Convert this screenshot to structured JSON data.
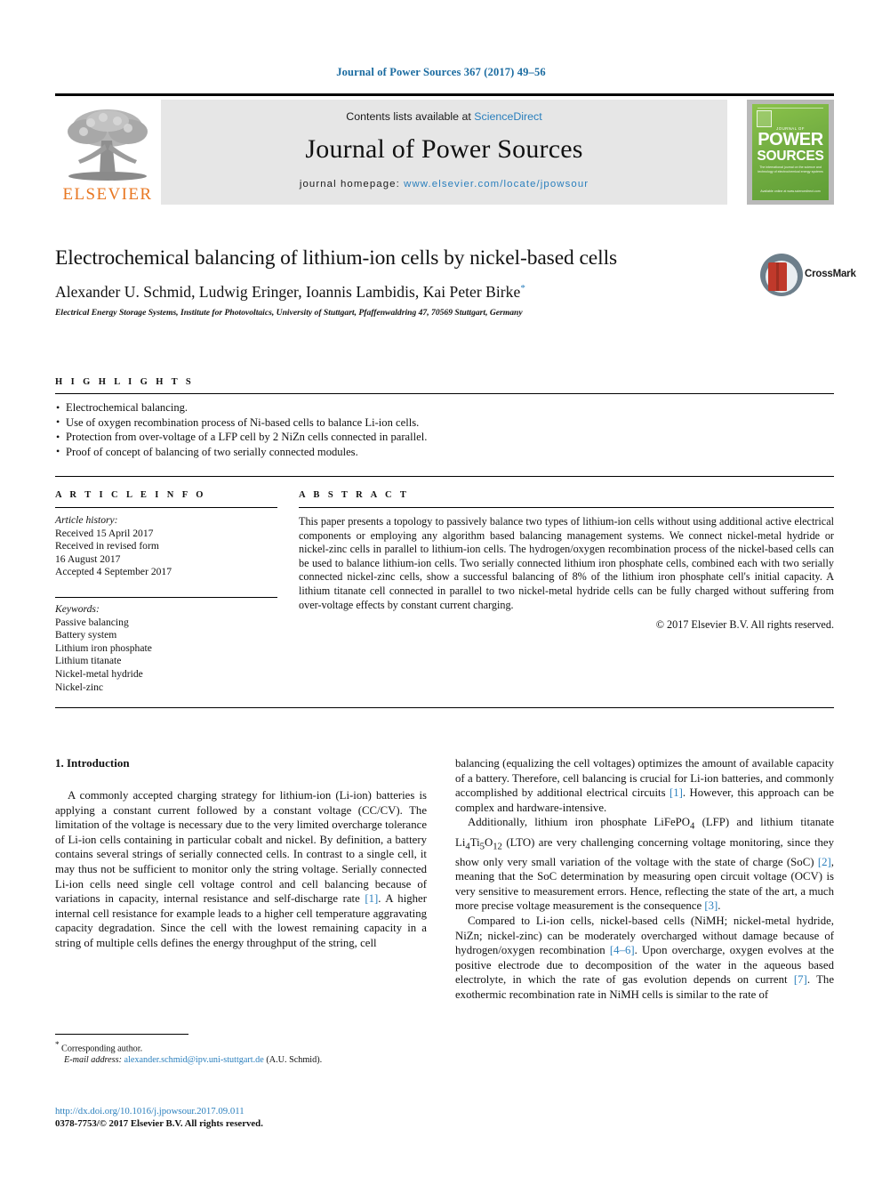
{
  "running_head": "Journal of Power Sources 367 (2017) 49–56",
  "masthead": {
    "contents_prefix": "Contents lists available at ",
    "sciencedirect": "ScienceDirect",
    "journal_title": "Journal of Power Sources",
    "homepage_label": "journal homepage: ",
    "homepage_url": "www.elsevier.com/locate/jpowsour",
    "publisher_wordmark": "ELSEVIER",
    "cover": {
      "eyebrow": "JOURNAL OF",
      "line1": "POWER",
      "line2": "SOURCES",
      "subtitle": "The international journal on the science and technology of electrochemical energy systems",
      "footer": "Available online at www.sciencedirect.com"
    }
  },
  "article": {
    "title": "Electrochemical balancing of lithium-ion cells by nickel-based cells",
    "authors": "Alexander U. Schmid, Ludwig Eringer, Ioannis Lambidis, Kai Peter Birke",
    "author_star": "*",
    "affiliation": "Electrical Energy Storage Systems, Institute for Photovoltaics, University of Stuttgart, Pfaffenwaldring 47, 70569 Stuttgart, Germany",
    "crossmark_label": "CrossMark"
  },
  "highlights": {
    "heading": "H I G H L I G H T S",
    "items": [
      "Electrochemical balancing.",
      "Use of oxygen recombination process of Ni-based cells to balance Li-ion cells.",
      "Protection from over-voltage of a LFP cell by 2 NiZn cells connected in parallel.",
      "Proof of concept of balancing of two serially connected modules."
    ]
  },
  "article_info": {
    "heading": "A R T I C L E   I N F O",
    "history_label": "Article history:",
    "history": [
      "Received 15 April 2017",
      "Received in revised form",
      "16 August 2017",
      "Accepted 4 September 2017"
    ],
    "keywords_label": "Keywords:",
    "keywords": [
      "Passive balancing",
      "Battery system",
      "Lithium iron phosphate",
      "Lithium titanate",
      "Nickel-metal hydride",
      "Nickel-zinc"
    ]
  },
  "abstract": {
    "heading": "A B S T R A C T",
    "text": "This paper presents a topology to passively balance two types of lithium-ion cells without using additional active electrical components or employing any algorithm based balancing management systems. We connect nickel-metal hydride or nickel-zinc cells in parallel to lithium-ion cells. The hydrogen/oxygen recombination process of the nickel-based cells can be used to balance lithium-ion cells. Two serially connected lithium iron phosphate cells, combined each with two serially connected nickel-zinc cells, show a successful balancing of 8% of the lithium iron phosphate cell's initial capacity. A lithium titanate cell connected in parallel to two nickel-metal hydride cells can be fully charged without suffering from over-voltage effects by constant current charging.",
    "copyright": "© 2017 Elsevier B.V. All rights reserved."
  },
  "body": {
    "section_heading": "1. Introduction",
    "left_p1_a": "A commonly accepted charging strategy for lithium-ion (Li-ion) batteries is applying a constant current followed by a constant voltage (CC/CV). The limitation of the voltage is necessary due to the very limited overcharge tolerance of Li-ion cells containing in particular cobalt and nickel. By definition, a battery contains several strings of serially connected cells. In contrast to a single cell, it may thus not be sufficient to monitor only the string voltage. Serially connected Li-ion cells need single cell voltage control and cell balancing because of variations in capacity, internal resistance and self-discharge rate ",
    "left_p1_ref": "[1]",
    "left_p1_b": ". A higher internal cell resistance for example leads to a higher cell temperature aggravating capacity degradation. Since the cell with the lowest remaining capacity in a string of multiple cells defines the energy throughput of the string, cell",
    "right_p1_a": "balancing (equalizing the cell voltages) optimizes the amount of available capacity of a battery. Therefore, cell balancing is crucial for Li-ion batteries, and commonly accomplished by additional electrical circuits ",
    "right_p1_ref": "[1]",
    "right_p1_b": ". However, this approach can be complex and hardware-intensive.",
    "right_p2_a": "Additionally, lithium iron phosphate LiFePO",
    "right_p2_sub1": "4",
    "right_p2_b": " (LFP) and lithium titanate Li",
    "right_p2_sub2": "4",
    "right_p2_c": "Ti",
    "right_p2_sub3": "5",
    "right_p2_d": "O",
    "right_p2_sub4": "12",
    "right_p2_e": " (LTO) are very challenging concerning voltage monitoring, since they show only very small variation of the voltage with the state of charge (SoC) ",
    "right_p2_ref1": "[2]",
    "right_p2_f": ", meaning that the SoC determination by measuring open circuit voltage (OCV) is very sensitive to measurement errors. Hence, reflecting the state of the art, a much more precise voltage measurement is the consequence ",
    "right_p2_ref2": "[3]",
    "right_p2_g": ".",
    "right_p3_a": "Compared to Li-ion cells, nickel-based cells (NiMH; nickel-metal hydride, NiZn; nickel-zinc) can be moderately overcharged without damage because of hydrogen/oxygen recombination ",
    "right_p3_ref1": "[4–6]",
    "right_p3_b": ". Upon overcharge, oxygen evolves at the positive electrode due to decomposition of the water in the aqueous based electrolyte, in which the rate of gas evolution depends on current ",
    "right_p3_ref2": "[7]",
    "right_p3_c": ". The exothermic recombination rate in NiMH cells is similar to the rate of"
  },
  "footer": {
    "corresponding_star": "*",
    "corresponding_label": "Corresponding author.",
    "email_label": "E-mail address:",
    "email": "alexander.schmid@ipv.uni-stuttgart.de",
    "email_suffix": "(A.U. Schmid).",
    "doi": "http://dx.doi.org/10.1016/j.jpowsour.2017.09.011",
    "issn": "0378-7753/© 2017 Elsevier B.V. All rights reserved."
  },
  "colors": {
    "link_blue": "#2a7fbd",
    "elsevier_orange": "#e87722",
    "cover_green": "#76b043",
    "crossmark_red": "#c0392b"
  }
}
